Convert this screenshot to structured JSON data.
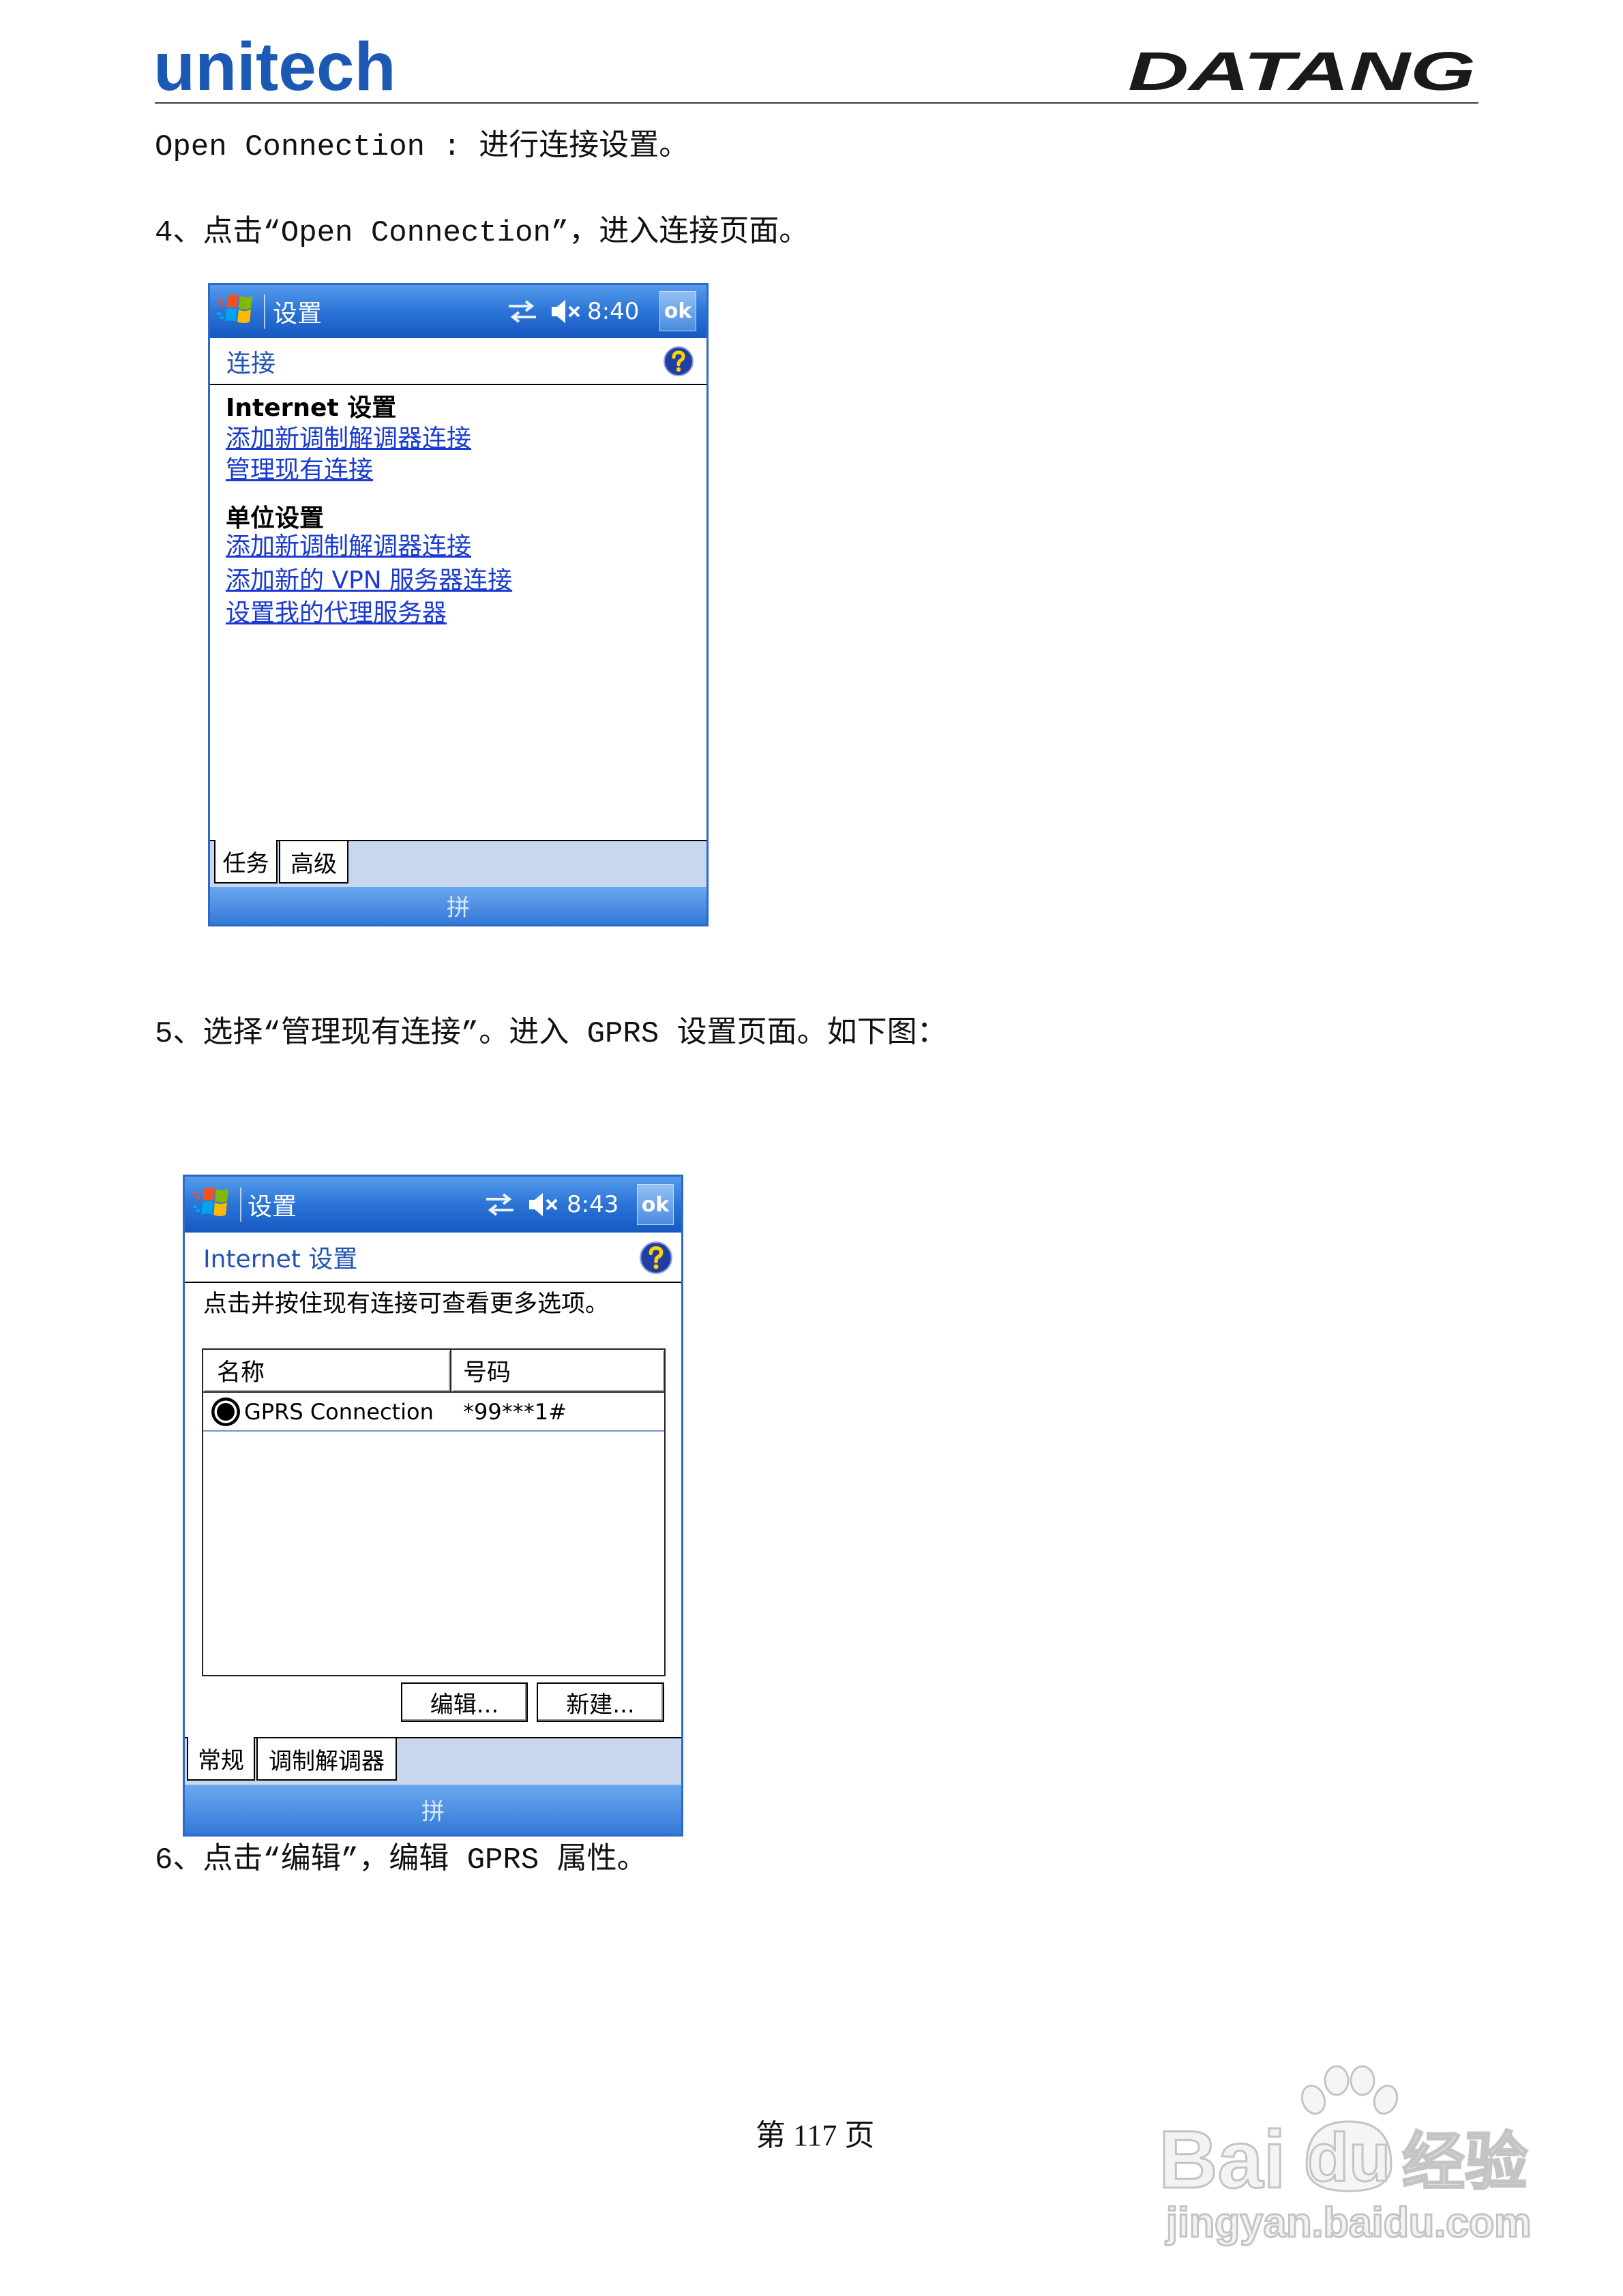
{
  "header": {
    "brand_left": "unitech",
    "brand_right": "DATANG"
  },
  "body": {
    "line1": "Open Connection : 进行连接设置。",
    "step4": "4、点击“Open Connection”，进入连接页面。",
    "step5": "5、选择“管理现有连接”。进入 GPRS 设置页面。如下图：",
    "step6": "6、点击“编辑”，编辑 GPRS 属性。"
  },
  "screen1": {
    "title": "设置",
    "time": "8:40",
    "ok": "ok",
    "heading": "连接",
    "sections": [
      {
        "title": "Internet 设置",
        "links": [
          "添加新调制解调器连接",
          "管理现有连接"
        ]
      },
      {
        "title": "单位设置",
        "links": [
          "添加新调制解调器连接",
          "添加新的 VPN 服务器连接",
          "设置我的代理服务器"
        ]
      }
    ],
    "tabs": [
      "任务",
      "高级"
    ],
    "selected_tab": "任务",
    "sip": "拼"
  },
  "screen2": {
    "title": "设置",
    "time": "8:43",
    "ok": "ok",
    "heading": "Internet 设置",
    "instruction": "点击并按住现有连接可查看更多选项。",
    "columns": [
      "名称",
      "号码"
    ],
    "rows": [
      {
        "name": "GPRS Connection",
        "number": "*99***1#"
      }
    ],
    "buttons": [
      "编辑...",
      "新建..."
    ],
    "tabs": [
      "常规",
      "调制解调器"
    ],
    "selected_tab": "常规",
    "sip": "拼"
  },
  "footer": {
    "page": "第 117 页"
  },
  "watermark": {
    "brand": "Bai",
    "brand_paw": "du",
    "brand_cn": "经验",
    "url": "jingyan.baidu.com"
  },
  "icons": {
    "start": "windows-flag-icon",
    "connectivity": "connectivity-icon",
    "volume": "volume-muted-icon",
    "help": "help-icon",
    "connection": "connection-radio-icon",
    "watermark": "baidu-paw-icon"
  },
  "colors": {
    "brand": "#1b59b5",
    "titlebar": "#2b74d6",
    "heading": "#2152b6",
    "link": "#1a3bd1",
    "tabstrip": "#c8d6ee"
  }
}
